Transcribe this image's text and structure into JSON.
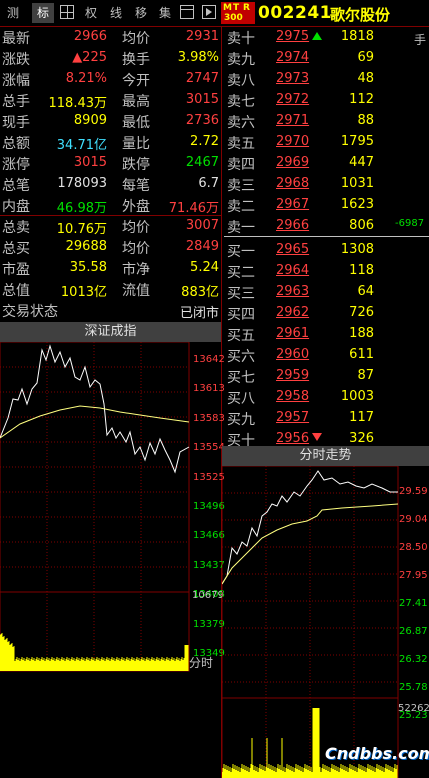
{
  "toolbar": {
    "buttons": [
      "测",
      "标",
      "权",
      "线",
      "移",
      "集"
    ],
    "mtr": [
      "M",
      "T",
      "R",
      "300"
    ],
    "code": "002241",
    "name": "歌尔股份",
    "extra": "手"
  },
  "quote": [
    {
      "l": "最新",
      "v": "2966",
      "vc": "red",
      "l2": "均价",
      "v2": "2931",
      "v2c": "red"
    },
    {
      "l": "涨跌",
      "v": "▲225",
      "vc": "red",
      "l2": "换手",
      "v2": "3.98%",
      "v2c": "yel"
    },
    {
      "l": "涨幅",
      "v": "8.21%",
      "vc": "red",
      "l2": "今开",
      "v2": "2747",
      "v2c": "red"
    },
    {
      "l": "总手",
      "v": "118.43万",
      "vc": "yel",
      "l2": "最高",
      "v2": "3015",
      "v2c": "red"
    },
    {
      "l": "现手",
      "v": "8909",
      "vc": "yel",
      "l2": "最低",
      "v2": "2736",
      "v2c": "red"
    },
    {
      "l": "总额",
      "v": "34.71亿",
      "vc": "cyan",
      "l2": "量比",
      "v2": "2.72",
      "v2c": "yel"
    },
    {
      "l": "涨停",
      "v": "3015",
      "vc": "red",
      "l2": "跌停",
      "v2": "2467",
      "v2c": "grn"
    },
    {
      "l": "总笔",
      "v": "178093",
      "vc": "wht",
      "l2": "每笔",
      "v2": "6.7",
      "v2c": "wht"
    },
    {
      "l": "内盘",
      "v": "46.98万",
      "vc": "grn",
      "l2": "外盘",
      "v2": "71.46万",
      "v2c": "red"
    },
    {
      "l": "总卖",
      "v": "10.76万",
      "vc": "yel",
      "l2": "均价",
      "v2": "3007",
      "v2c": "red"
    },
    {
      "l": "总买",
      "v": "29688",
      "vc": "yel",
      "l2": "均价",
      "v2": "2849",
      "v2c": "red"
    },
    {
      "l": "市盈",
      "v": "35.58",
      "vc": "yel",
      "l2": "市净",
      "v2": "5.24",
      "v2c": "yel"
    },
    {
      "l": "总值",
      "v": "1013亿",
      "vc": "yel",
      "l2": "流值",
      "v2": "883亿",
      "v2c": "yel"
    },
    {
      "l": "交易状态",
      "v": "",
      "vc": "wht",
      "l2": "",
      "v2": "已闭市",
      "v2c": "wht"
    }
  ],
  "orderbook": [
    {
      "l": "卖十",
      "p": "2975",
      "v": "1818"
    },
    {
      "l": "卖九",
      "p": "2974",
      "v": "69"
    },
    {
      "l": "卖八",
      "p": "2973",
      "v": "48"
    },
    {
      "l": "卖七",
      "p": "2972",
      "v": "112"
    },
    {
      "l": "卖六",
      "p": "2971",
      "v": "88"
    },
    {
      "l": "卖五",
      "p": "2970",
      "v": "1795"
    },
    {
      "l": "卖四",
      "p": "2969",
      "v": "447"
    },
    {
      "l": "卖三",
      "p": "2968",
      "v": "1031"
    },
    {
      "l": "卖二",
      "p": "2967",
      "v": "1623"
    },
    {
      "l": "卖一",
      "p": "2966",
      "v": "806"
    },
    {
      "l": "买一",
      "p": "2965",
      "v": "1308"
    },
    {
      "l": "买二",
      "p": "2964",
      "v": "118"
    },
    {
      "l": "买三",
      "p": "2963",
      "v": "64"
    },
    {
      "l": "买四",
      "p": "2962",
      "v": "726"
    },
    {
      "l": "买五",
      "p": "2961",
      "v": "188"
    },
    {
      "l": "买六",
      "p": "2960",
      "v": "611"
    },
    {
      "l": "买七",
      "p": "2959",
      "v": "87"
    },
    {
      "l": "买八",
      "p": "2958",
      "v": "1003"
    },
    {
      "l": "买九",
      "p": "2957",
      "v": "117"
    },
    {
      "l": "买十",
      "p": "2956",
      "v": "326"
    }
  ],
  "order_side_note": "-6987",
  "index_chart": {
    "title": "深证成指",
    "price_labels": [
      "13642",
      "13613",
      "13583",
      "13554",
      "13525",
      "13496",
      "13466",
      "13437",
      "13408",
      "13379",
      "13349"
    ],
    "volume_label": "10679",
    "time_label": "分时"
  },
  "stock_chart": {
    "title": "分时走势",
    "price_labels": [
      "29.59",
      "29.04",
      "28.50",
      "27.95",
      "27.41",
      "26.87",
      "26.32",
      "25.78",
      "25.23"
    ],
    "volume_label": "52262"
  },
  "watermark": "Cndbbs.com",
  "colors": {
    "up": "#ff4040",
    "down": "#00e000",
    "grid": "#800000",
    "price_line": "#ffffff",
    "avg_line": "#ffff80",
    "volume": "#ffff00"
  }
}
